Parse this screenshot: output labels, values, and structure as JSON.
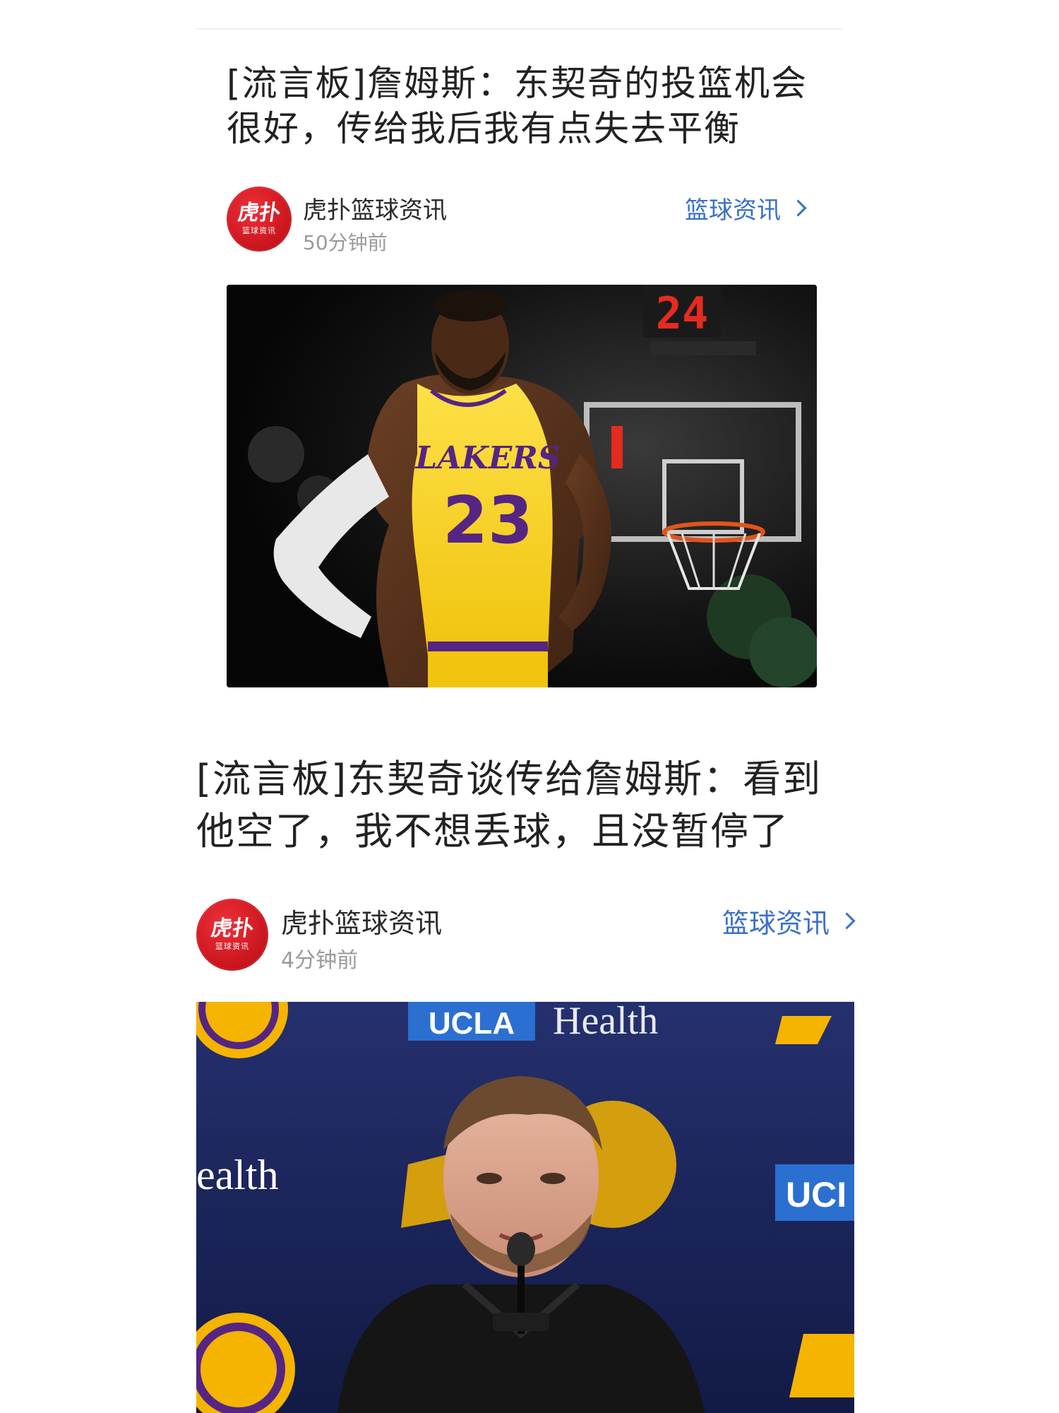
{
  "articles": [
    {
      "title_line1": "[流言板]詹姆斯：东契奇的投篮机会",
      "title_line2": "很好，传给我后我有点失去平衡",
      "source": {
        "name": "虎扑篮球资讯",
        "logo_text": "虎扑",
        "logo_subtext": "篮球资讯"
      },
      "time": "50分钟前",
      "category": "篮球资讯",
      "image": {
        "jersey_team": "LAKERS",
        "jersey_number": "23",
        "shot_clock": "24"
      }
    },
    {
      "title_line1": "[流言板]东契奇谈传给詹姆斯：看到",
      "title_line2": "他空了，我不想丢球，且没暂停了",
      "source": {
        "name": "虎扑篮球资讯",
        "logo_text": "虎扑",
        "logo_subtext": "篮球资讯"
      },
      "time": "4分钟前",
      "category": "篮球资讯",
      "image": {
        "backdrop_text_1": "UCLA",
        "backdrop_text_2": "Health",
        "backdrop_text_3": "ealth",
        "backdrop_text_4": "UCI"
      }
    }
  ],
  "colors": {
    "link": "#3a70c8",
    "time": "#9a9a9a",
    "logo_red": "#d21c24",
    "lakers_gold": "#f8d62a",
    "lakers_purple": "#552583"
  }
}
